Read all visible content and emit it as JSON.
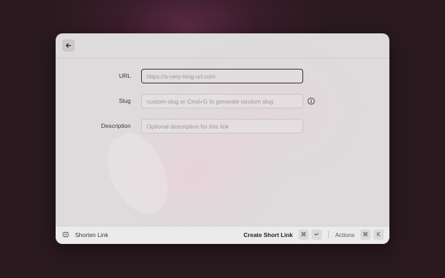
{
  "form": {
    "url": {
      "label": "URL",
      "value": "",
      "placeholder": "https://a-very-long-url.com"
    },
    "slug": {
      "label": "Slug",
      "value": "",
      "placeholder": "custom-slug or Cmd+G to generate random slug",
      "info_icon": "info-icon"
    },
    "description": {
      "label": "Description",
      "value": "",
      "placeholder": "Optional description for this link"
    }
  },
  "footer": {
    "command_title": "Shorten Link",
    "primary_action": "Create Short Link",
    "primary_shortcut": [
      "⌘",
      "↵"
    ],
    "secondary_action": "Actions",
    "secondary_shortcut": [
      "⌘",
      "K"
    ]
  },
  "icons": {
    "back": "arrow-left-icon",
    "command": "link-shortener-icon"
  }
}
